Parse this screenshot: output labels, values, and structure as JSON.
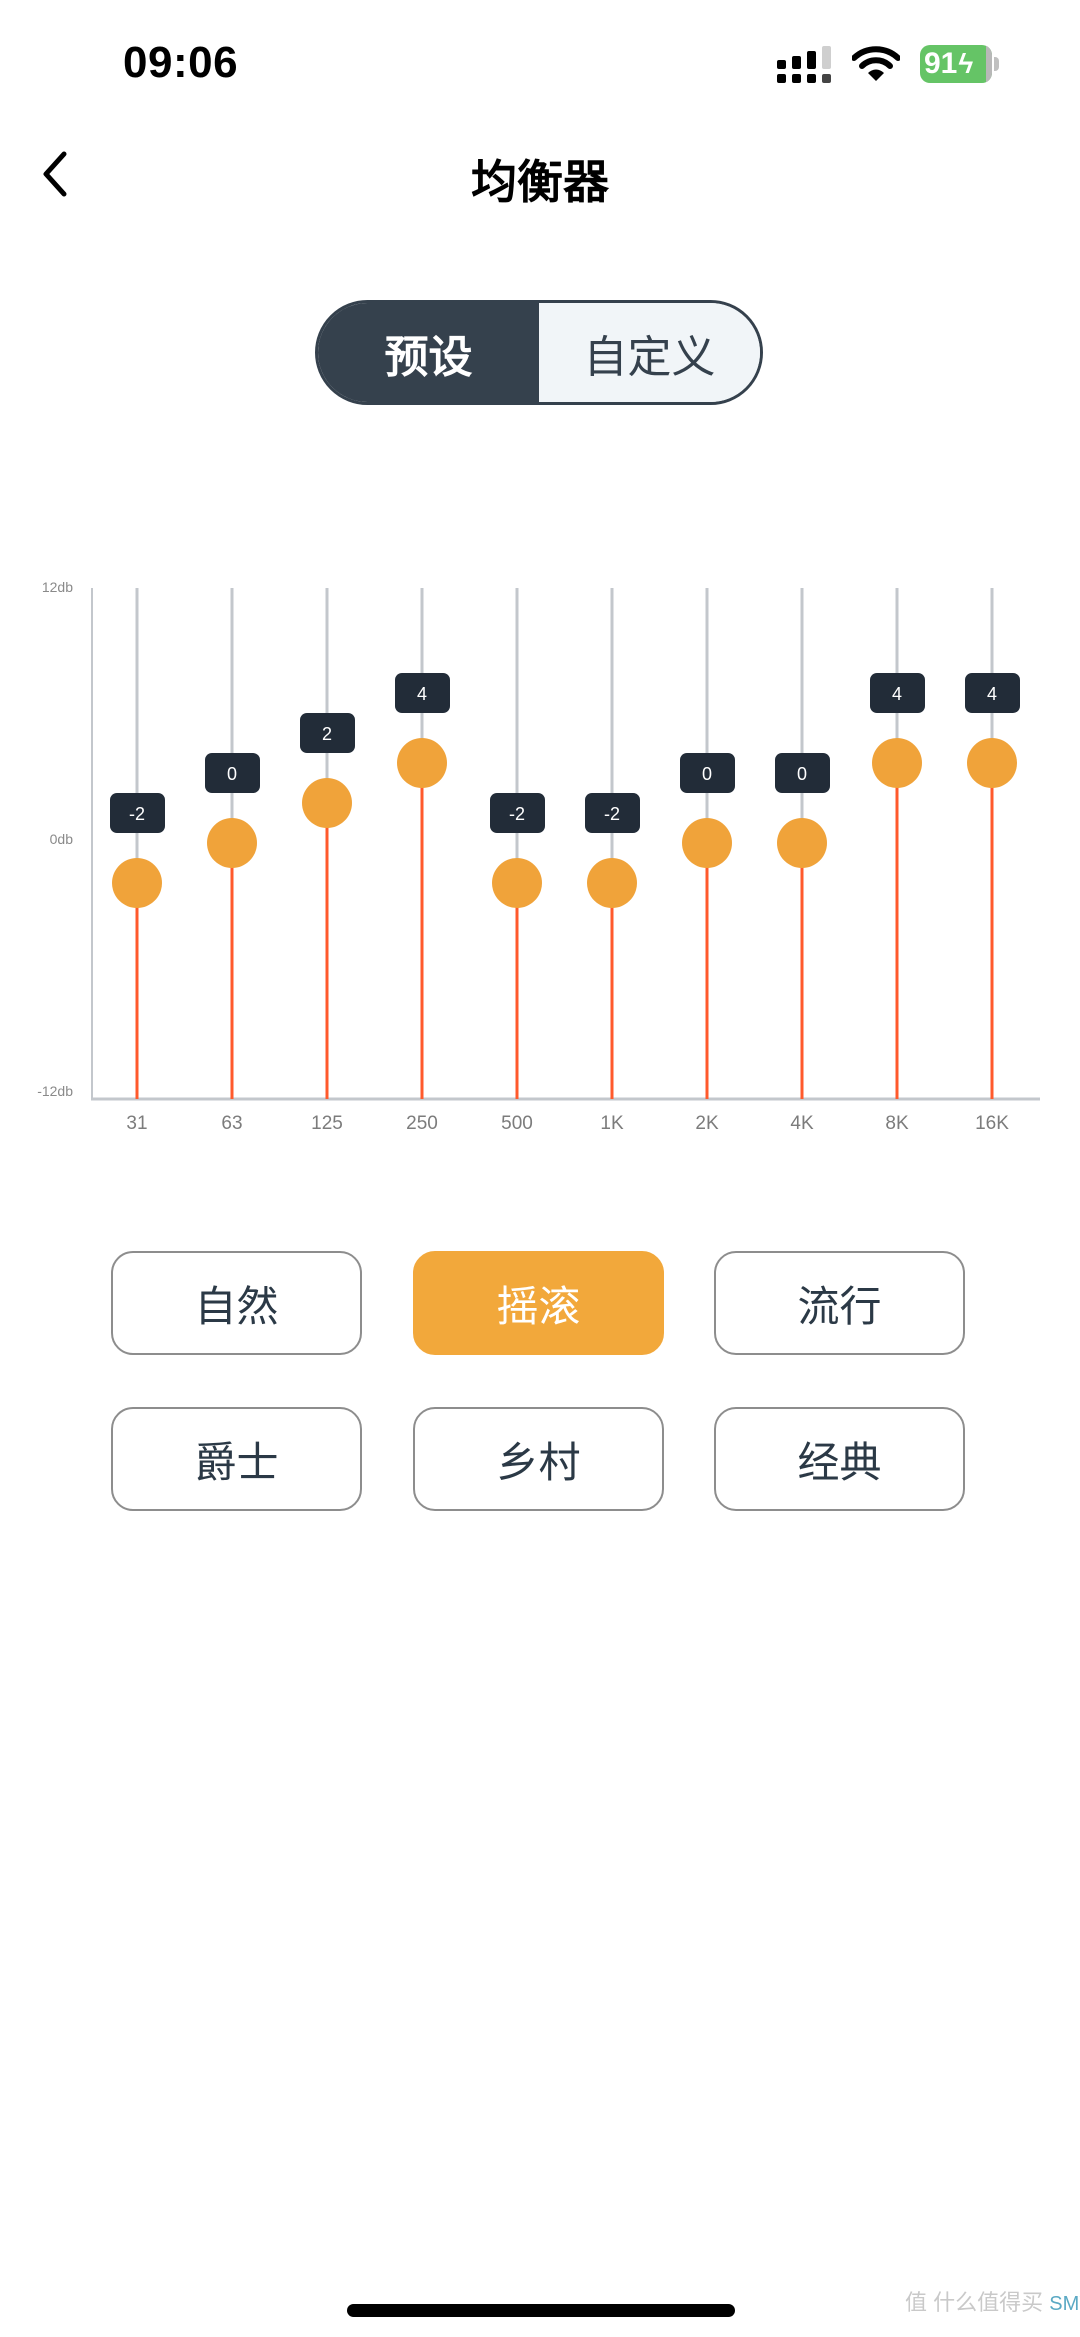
{
  "status_bar": {
    "time": "09:06",
    "battery_level": "91",
    "battery_charging_icon": "bolt-icon",
    "signal_icon": "cellular-signal-icon",
    "wifi_icon": "wifi-icon"
  },
  "nav": {
    "back_icon": "chevron-left-icon",
    "title": "均衡器"
  },
  "mode_tabs": [
    {
      "label": "预设",
      "active": true
    },
    {
      "label": "自定义",
      "active": false
    }
  ],
  "chart_data": {
    "type": "bar",
    "title": "",
    "xlabel": "",
    "ylabel": "",
    "y_tick_labels": [
      "12db",
      "0db",
      "-12db"
    ],
    "ylim": [
      -12,
      12
    ],
    "categories": [
      "31",
      "63",
      "125",
      "250",
      "500",
      "1K",
      "2K",
      "4K",
      "8K",
      "16K"
    ],
    "values": [
      -2,
      0,
      2,
      4,
      -2,
      -2,
      0,
      0,
      4,
      4
    ],
    "grid": false,
    "colors": {
      "knob": "#f0a33a",
      "active_track": "#ff5a2c",
      "inactive_track": "#c3c7cc",
      "value_badge": "#222c38",
      "axis": "#c3c7cc"
    }
  },
  "presets": {
    "selected": "摇滚",
    "items": [
      "自然",
      "摇滚",
      "流行",
      "爵士",
      "乡村",
      "经典"
    ]
  },
  "accent_color": "#f2a83b",
  "watermark": {
    "icon": "值",
    "text": "什么值得买",
    "site": "SMYZ.NET"
  }
}
